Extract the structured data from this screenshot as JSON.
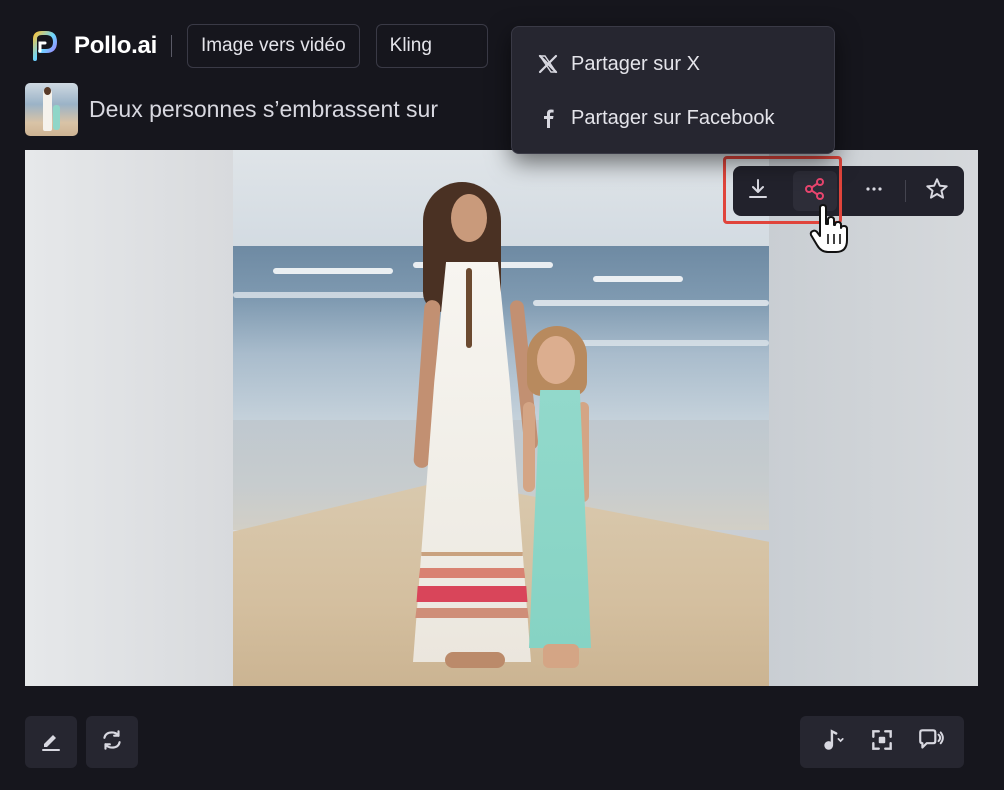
{
  "header": {
    "brand": "Pollo.ai",
    "mode_chip": "Image vers vidéo",
    "model_chip": "Kling"
  },
  "prompt": {
    "text": "Deux personnes s’embrassent sur"
  },
  "share_menu": {
    "items": [
      {
        "label": "Partager sur X",
        "icon": "x-logo-icon"
      },
      {
        "label": "Partager sur Facebook",
        "icon": "facebook-icon"
      }
    ]
  },
  "image_toolbar": {
    "buttons": [
      "download-icon",
      "share-icon",
      "more-icon",
      "star-icon"
    ],
    "share_highlighted": true
  },
  "bottom_toolbar": {
    "left": [
      "edit-icon",
      "regenerate-icon"
    ],
    "right": [
      "music-note-icon",
      "focus-frame-icon",
      "lip-sync-icon"
    ]
  },
  "colors": {
    "background": "#16161d",
    "accent_share": "#e8456e",
    "highlight": "#e0443b",
    "surface": "#262630"
  }
}
